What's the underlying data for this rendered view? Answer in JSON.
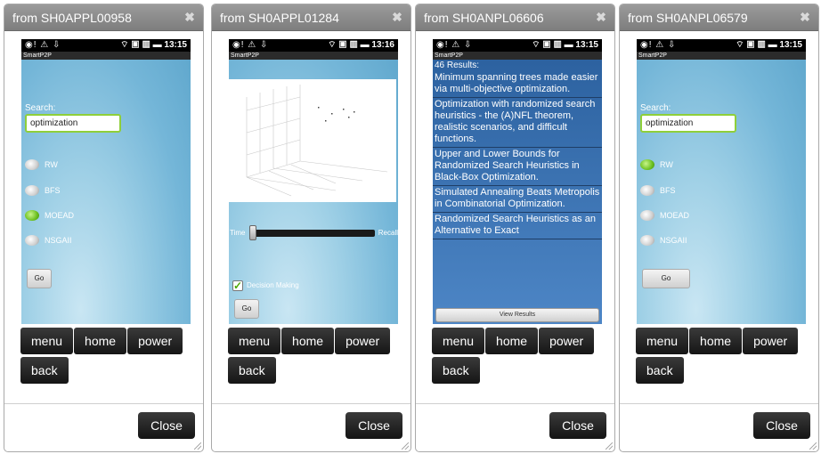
{
  "dialogs": [
    {
      "title": "from SH0APPL00958",
      "status": {
        "left": "◉! ⚠ ⇩",
        "right": "⌔ ▣ ▥ ▬ 13:15"
      },
      "app_name": "SmartP2P",
      "search_label": "Search:",
      "search_value": "optimization",
      "radios": [
        {
          "label": "RW",
          "selected": false
        },
        {
          "label": "BFS",
          "selected": false
        },
        {
          "label": "MOEAD",
          "selected": true
        },
        {
          "label": "NSGAII",
          "selected": false
        }
      ],
      "go_label": "Go"
    },
    {
      "title": "from SH0APPL01284",
      "status": {
        "left": "◉! ⚠ ⇩",
        "right": "⌔ ▣ ▥ ▬ 13:16"
      },
      "app_name": "SmartP2P",
      "time_label": "Time",
      "recall_label": "Recall",
      "slider_value": 0.02,
      "decision_label": "Decision Making",
      "decision_checked": true,
      "go_label": "Go"
    },
    {
      "title": "from SH0ANPL06606",
      "status": {
        "left": "◉! ⚠ ⇩",
        "right": "⌔ ▣ ▥ ▬ 13:15"
      },
      "app_name": "SmartP2P",
      "results_count": "46  Results:",
      "results": [
        "Minimum spanning trees made easier via multi-objective optimization.",
        "Optimization with randomized search heuristics - the (A)NFL theorem, realistic scenarios, and difficult functions.",
        "Upper and Lower Bounds for Randomized Search Heuristics in Black-Box Optimization.",
        "Simulated Annealing Beats Metropolis in Combinatorial Optimization.",
        "Randomized Search Heuristics as an Alternative to Exact"
      ],
      "view_results_label": "View Results"
    },
    {
      "title": "from SH0ANPL06579",
      "status": {
        "left": "◉! ⚠ ⇩",
        "right": "⌔ ▣ ▥ ▬ 13:15"
      },
      "app_name": "SmartP2P",
      "search_label": "Search:",
      "search_value": "optimization",
      "radios": [
        {
          "label": "RW",
          "selected": true
        },
        {
          "label": "BFS",
          "selected": false
        },
        {
          "label": "MOEAD",
          "selected": false
        },
        {
          "label": "NSGAII",
          "selected": false
        }
      ],
      "go_label": "Go"
    }
  ],
  "controls": {
    "menu": "menu",
    "home": "home",
    "power": "power",
    "back": "back",
    "close": "Close",
    "close_icon": "✖"
  },
  "colors": {
    "titlebar": "#8c8c8c",
    "phone_bg": "#7fbcdc",
    "radio_on": "#6cc020",
    "search_border": "#8fcf3a",
    "results_bg": "#3d72b4"
  }
}
